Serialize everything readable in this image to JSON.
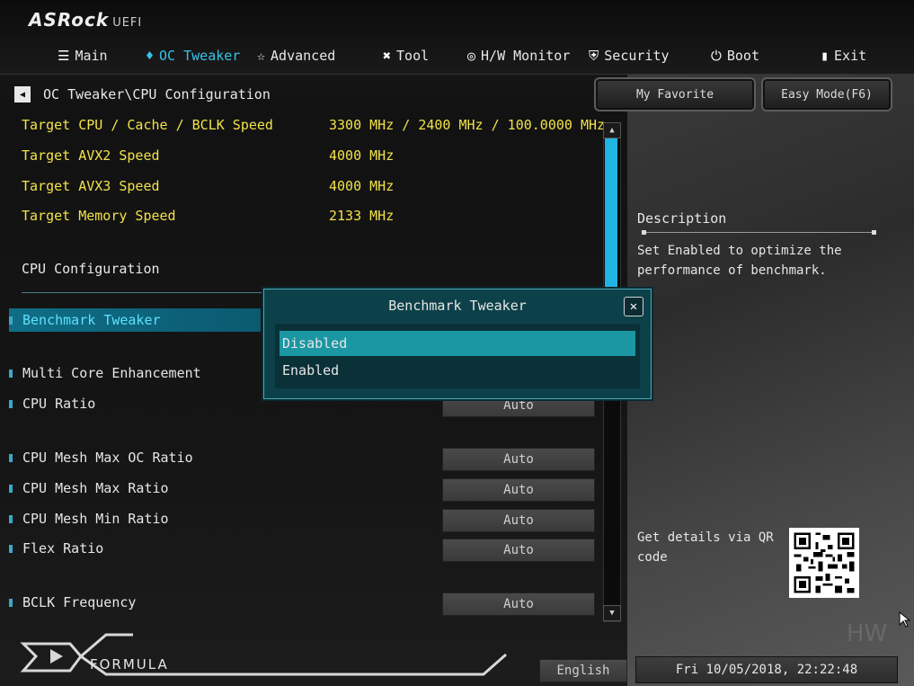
{
  "brand": {
    "logo": "ASRock",
    "suffix": "UEFI",
    "footer_logo": "FORMULA"
  },
  "tabs": [
    {
      "label": "Main",
      "icon": "list-icon"
    },
    {
      "label": "OC Tweaker",
      "icon": "flame-icon"
    },
    {
      "label": "Advanced",
      "icon": "star-icon"
    },
    {
      "label": "Tool",
      "icon": "tools-icon"
    },
    {
      "label": "H/W Monitor",
      "icon": "monitor-icon"
    },
    {
      "label": "Security",
      "icon": "shield-icon"
    },
    {
      "label": "Boot",
      "icon": "power-icon"
    },
    {
      "label": "Exit",
      "icon": "exit-icon"
    }
  ],
  "active_tab": "OC Tweaker",
  "breadcrumb": "OC Tweaker\\CPU Configuration",
  "buttons": {
    "favorite": "My Favorite",
    "easy_mode": "Easy Mode(F6)"
  },
  "targets": [
    {
      "label": "Target CPU / Cache / BCLK Speed",
      "value": "3300 MHz / 2400 MHz / 100.0000 MHz"
    },
    {
      "label": "Target AVX2 Speed",
      "value": "4000 MHz"
    },
    {
      "label": "Target AVX3 Speed",
      "value": "4000 MHz"
    },
    {
      "label": "Target Memory Speed",
      "value": "2133 MHz"
    }
  ],
  "section_title": "CPU Configuration",
  "settings": [
    {
      "label": "Benchmark Tweaker",
      "value": ""
    },
    {
      "label": "Multi Core Enhancement",
      "value": ""
    },
    {
      "label": "CPU Ratio",
      "value": "Auto"
    },
    {
      "label": "CPU Mesh Max OC Ratio",
      "value": "Auto"
    },
    {
      "label": "CPU Mesh Max Ratio",
      "value": "Auto"
    },
    {
      "label": "CPU Mesh Min Ratio",
      "value": "Auto"
    },
    {
      "label": "Flex Ratio",
      "value": "Auto"
    },
    {
      "label": "BCLK Frequency",
      "value": "Auto"
    }
  ],
  "description": {
    "title": "Description",
    "text": "Set Enabled to optimize the performance of benchmark."
  },
  "qr_text": "Get details via QR code",
  "language": "English",
  "datetime": "Fri 10/05/2018, 22:22:48",
  "modal": {
    "title": "Benchmark Tweaker",
    "options": [
      "Disabled",
      "Enabled"
    ],
    "selected": "Disabled"
  },
  "colors": {
    "accent": "#34c4e8",
    "target_text": "#f2e24a",
    "modal_bg": "#0d4149",
    "selection": "#1b97a3"
  }
}
